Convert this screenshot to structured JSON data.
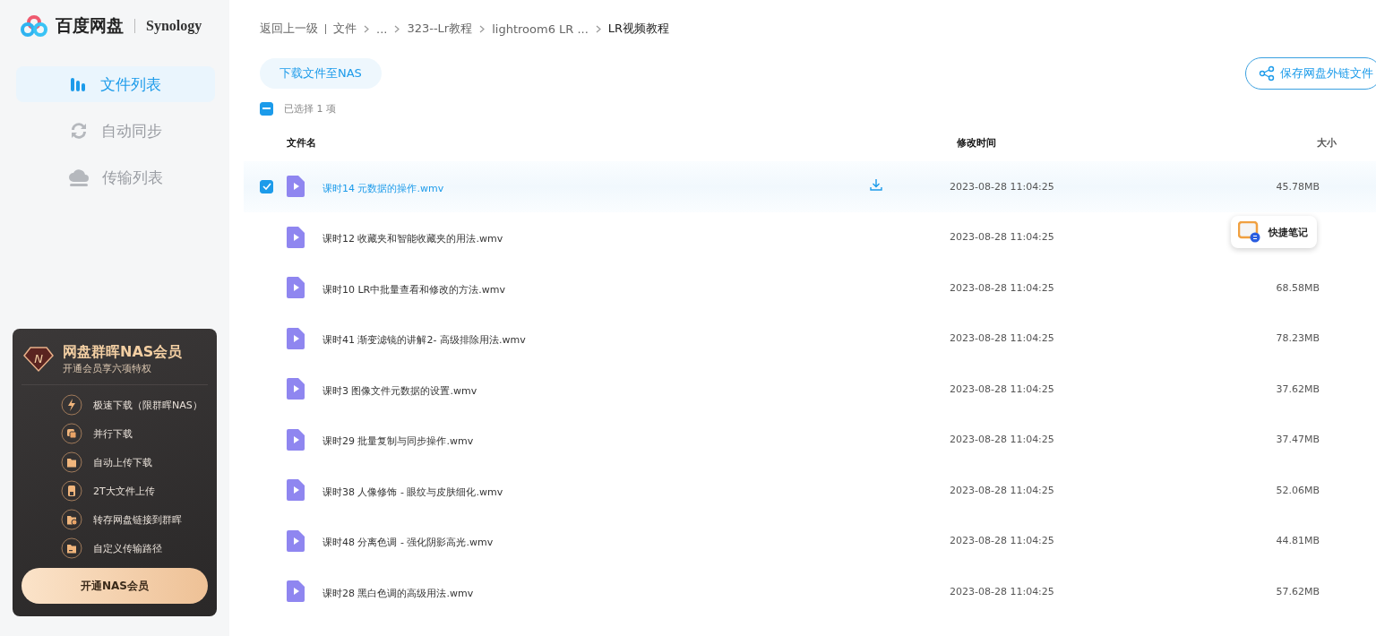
{
  "logo": {
    "brand": "百度网盘",
    "partner": "Synology"
  },
  "nav": [
    {
      "label": "文件列表",
      "selected": true
    },
    {
      "label": "自动同步",
      "selected": false
    },
    {
      "label": "传输列表",
      "selected": false
    }
  ],
  "promo": {
    "badge": "N",
    "title": "网盘群晖NAS会员",
    "subtitle": "开通会员享六项特权",
    "perks": [
      "极速下载（限群晖NAS）",
      "并行下载",
      "自动上传下载",
      "2T大文件上传",
      "转存网盘链接到群晖",
      "自定义传输路径"
    ],
    "button": "开通NAS会员"
  },
  "breadcrumb": [
    {
      "label": "返回上一级",
      "current": false
    },
    {
      "label": "文件",
      "current": false
    },
    {
      "label": "...",
      "current": false
    },
    {
      "label": "323--Lr教程",
      "current": false
    },
    {
      "label": "lightroom6 LR ...",
      "current": false
    },
    {
      "label": "LR视频教程",
      "current": true
    }
  ],
  "toolbar": {
    "download_button": "下载文件至NAS",
    "save_link_button": "保存网盘外链文件"
  },
  "selection": {
    "indeterminate": true,
    "label": "已选择 1 项"
  },
  "table": {
    "columns": [
      "文件名",
      "修改时间",
      "大小"
    ],
    "rows": [
      {
        "name": "课时14 元数据的操作.wmv",
        "time": "2023-08-28 11:04:25",
        "size": "45.78MB",
        "selected": true
      },
      {
        "name": "课时12 收藏夹和智能收藏夹的用法.wmv",
        "time": "2023-08-28 11:04:25",
        "selected": false
      },
      {
        "name": "课时10 LR中批量查看和修改的方法.wmv",
        "time": "2023-08-28 11:04:25",
        "size": "68.58MB",
        "selected": false
      },
      {
        "name": "课时41 渐变滤镜的讲解2- 高级排除用法.wmv",
        "time": "2023-08-28 11:04:25",
        "size": "78.23MB",
        "selected": false
      },
      {
        "name": "课时3 图像文件元数据的设置.wmv",
        "time": "2023-08-28 11:04:25",
        "size": "37.62MB",
        "selected": false
      },
      {
        "name": "课时29 批量复制与同步操作.wmv",
        "time": "2023-08-28 11:04:25",
        "size": "37.47MB",
        "selected": false
      },
      {
        "name": "课时38 人像修饰 - 眼纹与皮肤细化.wmv",
        "time": "2023-08-28 11:04:25",
        "size": "52.06MB",
        "selected": false
      },
      {
        "name": "课时48 分离色调 - 强化阴影高光.wmv",
        "time": "2023-08-28 11:04:25",
        "size": "44.81MB",
        "selected": false
      },
      {
        "name": "课时28 黑白色调的高级用法.wmv",
        "time": "2023-08-28 11:04:25",
        "size": "57.62MB",
        "selected": false
      }
    ]
  },
  "quick_note": {
    "label": "快捷笔记"
  }
}
